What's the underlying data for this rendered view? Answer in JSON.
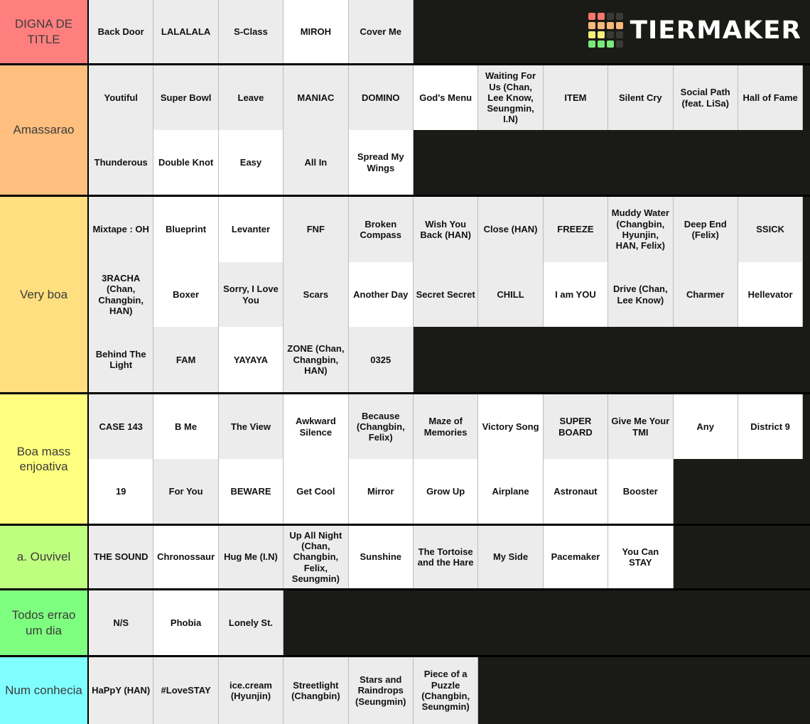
{
  "brand": {
    "name": "TIERMAKER",
    "logo_colors": [
      [
        "#f8766d",
        "#f8766d",
        "#3a3a35",
        "#3a3a35"
      ],
      [
        "#f8b878",
        "#f8b878",
        "#f8b878",
        "#f8b878"
      ],
      [
        "#f5f07a",
        "#f5f07a",
        "#3a3a35",
        "#3a3a35"
      ],
      [
        "#7ae87a",
        "#7ae87a",
        "#7ae87a",
        "#3a3a35"
      ]
    ]
  },
  "colors": {
    "tier_1": "#FF7F7F",
    "tier_2": "#FFBF7F",
    "tier_3": "#FFDF7F",
    "tier_4": "#FFFF7F",
    "tier_5": "#BFFF7F",
    "tier_6": "#7FFF7F",
    "tier_7": "#7FFFFF",
    "background": "#1a1a17",
    "cell_gray": "#ececec",
    "cell_white": "#ffffff"
  },
  "tiers": [
    {
      "label": "DIGNA DE TITLE",
      "color": "#FF7F7F",
      "rows": [
        [
          {
            "text": "Back Door",
            "bg": "gray"
          },
          {
            "text": "LALALALA",
            "bg": "gray"
          },
          {
            "text": "S-Class",
            "bg": "gray"
          },
          {
            "text": "MIROH",
            "bg": "white"
          },
          {
            "text": "Cover Me",
            "bg": "gray"
          }
        ]
      ]
    },
    {
      "label": "Amassarao",
      "color": "#FFBF7F",
      "rows": [
        [
          {
            "text": "Youtiful",
            "bg": "gray"
          },
          {
            "text": "Super Bowl",
            "bg": "gray"
          },
          {
            "text": "Leave",
            "bg": "gray"
          },
          {
            "text": "MANIAC",
            "bg": "gray"
          },
          {
            "text": "DOMINO",
            "bg": "gray"
          },
          {
            "text": "God's Menu",
            "bg": "white"
          },
          {
            "text": "Waiting For Us (Chan, Lee Know, Seungmin, I.N)",
            "bg": "gray"
          },
          {
            "text": "ITEM",
            "bg": "gray"
          },
          {
            "text": "Silent Cry",
            "bg": "gray"
          },
          {
            "text": "Social Path (feat. LiSa)",
            "bg": "gray"
          },
          {
            "text": "Hall of Fame",
            "bg": "gray"
          }
        ],
        [
          {
            "text": "Thunderous",
            "bg": "gray"
          },
          {
            "text": "Double Knot",
            "bg": "white"
          },
          {
            "text": "Easy",
            "bg": "white"
          },
          {
            "text": "All In",
            "bg": "gray"
          },
          {
            "text": "Spread My Wings",
            "bg": "white"
          }
        ]
      ]
    },
    {
      "label": "Very boa",
      "color": "#FFDF7F",
      "rows": [
        [
          {
            "text": "Mixtape : OH",
            "bg": "gray"
          },
          {
            "text": "Blueprint",
            "bg": "white"
          },
          {
            "text": "Levanter",
            "bg": "white"
          },
          {
            "text": "FNF",
            "bg": "gray"
          },
          {
            "text": "Broken Compass",
            "bg": "gray"
          },
          {
            "text": "Wish You Back (HAN)",
            "bg": "gray"
          },
          {
            "text": "Close (HAN)",
            "bg": "gray"
          },
          {
            "text": "FREEZE",
            "bg": "gray"
          },
          {
            "text": "Muddy Water (Changbin, Hyunjin, HAN, Felix)",
            "bg": "gray"
          },
          {
            "text": "Deep End (Felix)",
            "bg": "gray"
          },
          {
            "text": "SSICK",
            "bg": "gray"
          }
        ],
        [
          {
            "text": "3RACHA (Chan, Changbin, HAN)",
            "bg": "gray"
          },
          {
            "text": "Boxer",
            "bg": "white"
          },
          {
            "text": "Sorry, I Love You",
            "bg": "gray"
          },
          {
            "text": "Scars",
            "bg": "gray"
          },
          {
            "text": "Another Day",
            "bg": "white"
          },
          {
            "text": "Secret Secret",
            "bg": "gray"
          },
          {
            "text": "CHILL",
            "bg": "gray"
          },
          {
            "text": "I am YOU",
            "bg": "white"
          },
          {
            "text": "Drive (Chan, Lee Know)",
            "bg": "gray"
          },
          {
            "text": "Charmer",
            "bg": "gray"
          },
          {
            "text": "Hellevator",
            "bg": "white"
          }
        ],
        [
          {
            "text": "Behind The Light",
            "bg": "gray"
          },
          {
            "text": "FAM",
            "bg": "gray"
          },
          {
            "text": "YAYAYA",
            "bg": "white"
          },
          {
            "text": "ZONE (Chan, Changbin, HAN)",
            "bg": "gray"
          },
          {
            "text": "0325",
            "bg": "gray"
          }
        ]
      ]
    },
    {
      "label": "Boa mass enjoativa",
      "color": "#FFFF7F",
      "rows": [
        [
          {
            "text": "CASE 143",
            "bg": "gray"
          },
          {
            "text": "B Me",
            "bg": "white"
          },
          {
            "text": "The View",
            "bg": "gray"
          },
          {
            "text": "Awkward Silence",
            "bg": "white"
          },
          {
            "text": "Because (Changbin, Felix)",
            "bg": "gray"
          },
          {
            "text": "Maze of Memories",
            "bg": "gray"
          },
          {
            "text": "Victory Song",
            "bg": "white"
          },
          {
            "text": "SUPER BOARD",
            "bg": "gray"
          },
          {
            "text": "Give Me Your TMI",
            "bg": "gray"
          },
          {
            "text": "Any",
            "bg": "white"
          },
          {
            "text": "District 9",
            "bg": "white"
          }
        ],
        [
          {
            "text": "19",
            "bg": "white"
          },
          {
            "text": "For You",
            "bg": "gray"
          },
          {
            "text": "BEWARE",
            "bg": "white"
          },
          {
            "text": "Get Cool",
            "bg": "white"
          },
          {
            "text": "Mirror",
            "bg": "white"
          },
          {
            "text": "Grow Up",
            "bg": "white"
          },
          {
            "text": "Airplane",
            "bg": "white"
          },
          {
            "text": "Astronaut",
            "bg": "white"
          },
          {
            "text": "Booster",
            "bg": "white"
          }
        ]
      ]
    },
    {
      "label": "a. Ouvivel",
      "color": "#BFFF7F",
      "rows": [
        [
          {
            "text": "THE SOUND",
            "bg": "gray"
          },
          {
            "text": "Chronossaur",
            "bg": "white"
          },
          {
            "text": "Hug Me (I.N)",
            "bg": "gray"
          },
          {
            "text": "Up All Night (Chan, Changbin, Felix, Seungmin)",
            "bg": "gray"
          },
          {
            "text": "Sunshine",
            "bg": "white"
          },
          {
            "text": "The Tortoise and the Hare",
            "bg": "gray"
          },
          {
            "text": "My Side",
            "bg": "gray"
          },
          {
            "text": "Pacemaker",
            "bg": "white"
          },
          {
            "text": "You Can STAY",
            "bg": "white"
          }
        ]
      ]
    },
    {
      "label": "Todos errao um dia",
      "color": "#7FFF7F",
      "rows": [
        [
          {
            "text": "N/S",
            "bg": "gray"
          },
          {
            "text": "Phobia",
            "bg": "white"
          },
          {
            "text": "Lonely St.",
            "bg": "gray"
          }
        ]
      ]
    },
    {
      "label": "Num conhecia",
      "color": "#7FFFFF",
      "rows": [
        [
          {
            "text": "HaPpY (HAN)",
            "bg": "gray"
          },
          {
            "text": "#LoveSTAY",
            "bg": "gray"
          },
          {
            "text": "ice.cream (Hyunjin)",
            "bg": "gray"
          },
          {
            "text": "Streetlight (Changbin)",
            "bg": "gray"
          },
          {
            "text": "Stars and Raindrops (Seungmin)",
            "bg": "gray"
          },
          {
            "text": "Piece of a Puzzle (Changbin, Seungmin)",
            "bg": "gray"
          }
        ]
      ]
    }
  ]
}
